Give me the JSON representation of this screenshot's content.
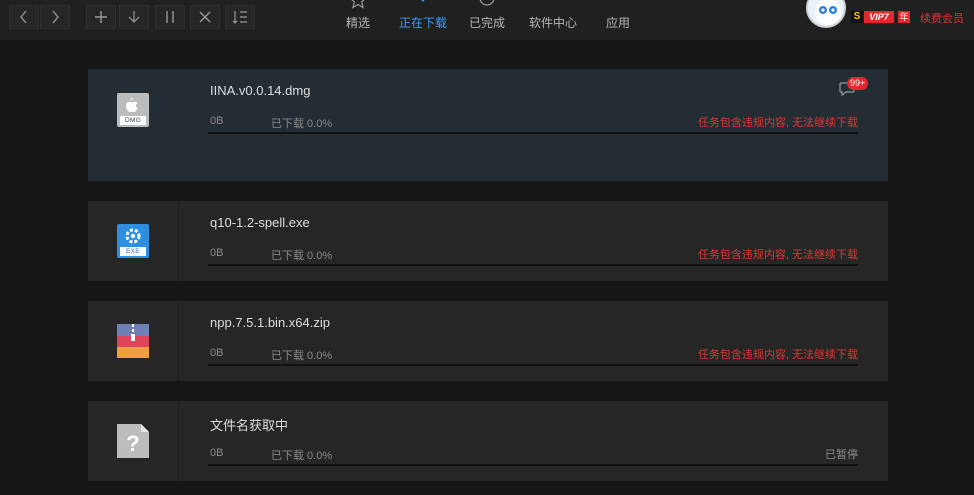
{
  "toolbar": {
    "back": "back-arrow",
    "forward": "forward-arrow",
    "add": "plus",
    "download": "down-arrow",
    "pause": "pause",
    "delete": "close",
    "sort": "sort-list"
  },
  "nav": {
    "tabs": [
      {
        "label": "精选",
        "icon": "star-icon"
      },
      {
        "label": "正在下载",
        "icon": "download-icon",
        "active": true
      },
      {
        "label": "已完成",
        "icon": "check-icon"
      },
      {
        "label": "软件中心",
        "icon": "monitor-icon"
      },
      {
        "label": "应用",
        "icon": "grid-icon"
      }
    ]
  },
  "user": {
    "s_badge": "S",
    "vip_badge": "VIP7",
    "year_badge": "年",
    "renew": "续费会员",
    "accent": "#e03030"
  },
  "downloads": [
    {
      "name": "IINA.v0.0.14.dmg",
      "size": "0B",
      "progress": "已下载 0.0%",
      "status": "任务包含违规内容, 无法继续下载",
      "icon_label": "DMG",
      "icon": "apple-dmg-file-icon"
    },
    {
      "name": "q10-1.2-spell.exe",
      "size": "0B",
      "progress": "已下载 0.0%",
      "status": "任务包含违规内容, 无法继续下载",
      "icon_label": "EXE",
      "icon": "exe-file-icon"
    },
    {
      "name": "npp.7.5.1.bin.x64.zip",
      "size": "0B",
      "progress": "已下载 0.0%",
      "status": "任务包含违规内容, 无法继续下载",
      "icon": "zip-file-icon"
    },
    {
      "name": "文件名获取中",
      "size": "0B",
      "progress": "已下载 0.0%",
      "status": "已暂停",
      "icon": "unknown-file-icon"
    }
  ],
  "message_badge": "99+"
}
